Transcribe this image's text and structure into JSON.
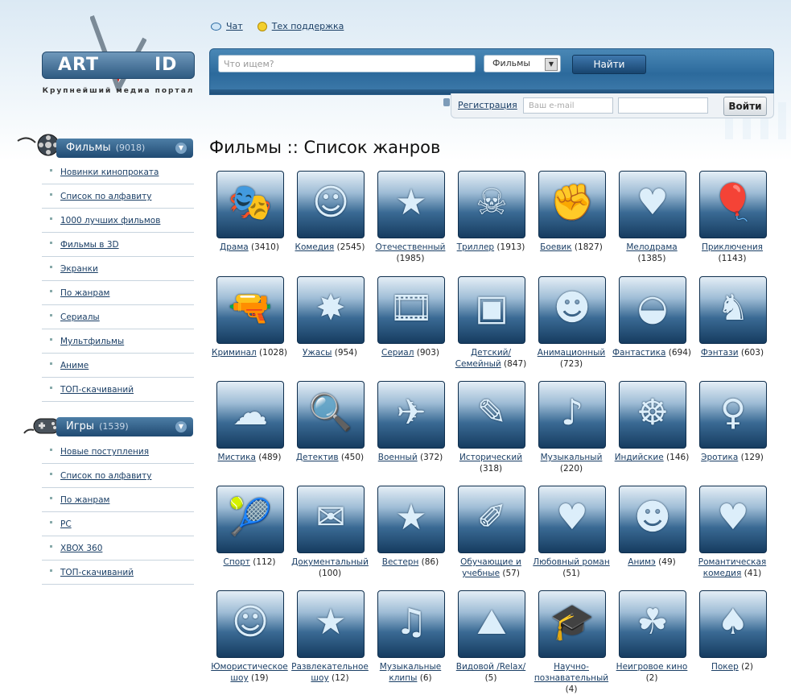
{
  "header": {
    "logo_left": "ART",
    "logo_right": "ID",
    "tagline": "Крупнейший медиа портал",
    "links": {
      "chat": "Чат",
      "support": "Тех поддержка"
    }
  },
  "search": {
    "placeholder": "Что ищем?",
    "category": "Фильмы",
    "button": "Найти"
  },
  "login": {
    "register": "Регистрация",
    "email_placeholder": "Ваш e-mail",
    "button": "Войти"
  },
  "sidebar": {
    "films": {
      "title": "Фильмы",
      "count": "(9018)",
      "items": [
        "Новинки кинопроката",
        "Список по алфавиту",
        "1000 лучших фильмов",
        "Фильмы в 3D",
        "Экранки",
        "По жанрам",
        "Сериалы",
        "Мультфильмы",
        "Аниме",
        "ТОП-скачиваний"
      ]
    },
    "games": {
      "title": "Игры",
      "count": "(1539)",
      "items": [
        "Новые поступления",
        "Список по алфавиту",
        "По жанрам",
        "PC",
        "XBOX 360",
        "ТОП-скачиваний"
      ]
    }
  },
  "main": {
    "title": "Фильмы :: Список жанров",
    "genres": [
      {
        "name": "Драма",
        "count": "(3410)"
      },
      {
        "name": "Комедия",
        "count": "(2545)"
      },
      {
        "name": "Отечественный",
        "count": "(1985)"
      },
      {
        "name": "Триллер",
        "count": "(1913)"
      },
      {
        "name": "Боевик",
        "count": "(1827)"
      },
      {
        "name": "Мелодрама",
        "count": "(1385)"
      },
      {
        "name": "Приключения",
        "count": "(1143)"
      },
      {
        "name": "Криминал",
        "count": "(1028)"
      },
      {
        "name": "Ужасы",
        "count": "(954)"
      },
      {
        "name": "Сериал",
        "count": "(903)"
      },
      {
        "name": "Детский/Семейный",
        "count": "(847)"
      },
      {
        "name": "Анимационный",
        "count": "(723)"
      },
      {
        "name": "Фантастика",
        "count": "(694)"
      },
      {
        "name": "Фэнтази",
        "count": "(603)"
      },
      {
        "name": "Мистика",
        "count": "(489)"
      },
      {
        "name": "Детектив",
        "count": "(450)"
      },
      {
        "name": "Военный",
        "count": "(372)"
      },
      {
        "name": "Исторический",
        "count": "(318)"
      },
      {
        "name": "Музыкальный",
        "count": "(220)"
      },
      {
        "name": "Индийские",
        "count": "(146)"
      },
      {
        "name": "Эротика",
        "count": "(129)"
      },
      {
        "name": "Спорт",
        "count": "(112)"
      },
      {
        "name": "Документальный",
        "count": "(100)"
      },
      {
        "name": "Вестерн",
        "count": "(86)"
      },
      {
        "name": "Обучающие и учебные",
        "count": "(57)"
      },
      {
        "name": "Любовный роман",
        "count": "(51)"
      },
      {
        "name": "Анимэ",
        "count": "(49)"
      },
      {
        "name": "Романтическая комедия",
        "count": "(41)"
      },
      {
        "name": "Юмористическое шоу",
        "count": "(19)"
      },
      {
        "name": "Развлекательное шоу",
        "count": "(12)"
      },
      {
        "name": "Музыкальные клипы",
        "count": "(6)"
      },
      {
        "name": "Видовой /Relax/",
        "count": "(5)"
      },
      {
        "name": "Научно-познавательный",
        "count": "(4)"
      },
      {
        "name": "Неигровое кино",
        "count": "(2)"
      },
      {
        "name": "Покер",
        "count": "(2)"
      }
    ]
  }
}
